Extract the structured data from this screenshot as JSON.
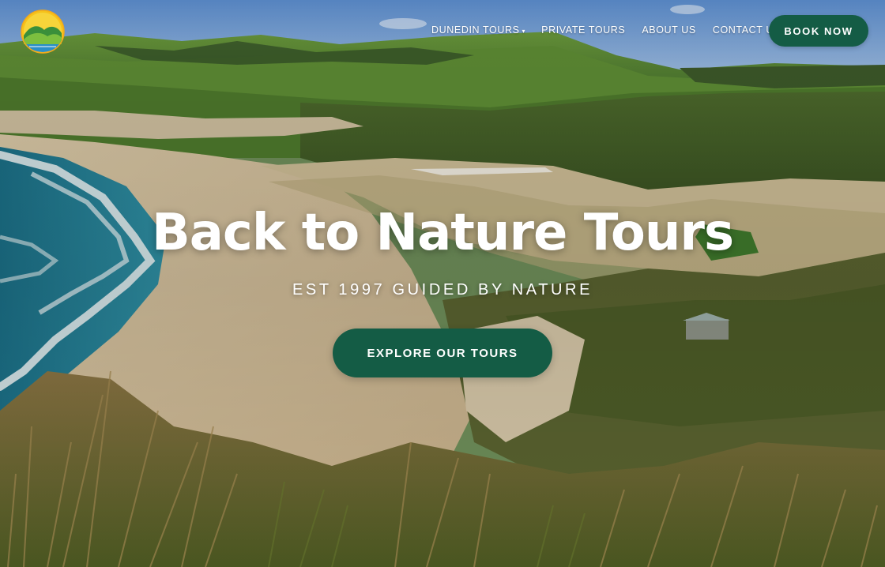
{
  "brand": {
    "logo_icon": "sun-over-hills-logo",
    "accent_color": "#145c45"
  },
  "nav": {
    "items": [
      {
        "label": "DUNEDIN TOURS",
        "has_dropdown": true
      },
      {
        "label": "PRIVATE TOURS",
        "has_dropdown": false
      },
      {
        "label": "ABOUT US",
        "has_dropdown": false
      },
      {
        "label": "CONTACT US",
        "has_dropdown": false
      }
    ],
    "dropdown_icon": "▾",
    "book_label": "BOOK NOW"
  },
  "hero": {
    "title": "Back to Nature Tours",
    "subtitle": "EST 1997 GUIDED BY NATURE",
    "cta_label": "EXPLORE OUR TOURS",
    "background_image": "coastal beach, sand dunes and green hills landscape"
  }
}
